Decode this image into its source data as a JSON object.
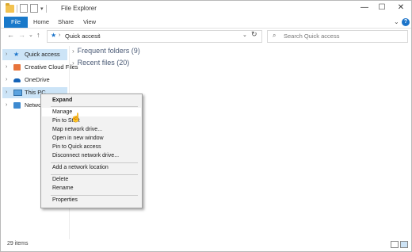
{
  "window": {
    "title": "File Explorer",
    "controls": {
      "minimize": "—",
      "maximize": "☐",
      "close": "✕"
    }
  },
  "ribbon": {
    "tabs": [
      "File",
      "Home",
      "Share",
      "View"
    ],
    "help": "?",
    "expand_chevron": "⌄"
  },
  "nav": {
    "back": "←",
    "forward": "→",
    "recent": "⌄",
    "up": "↑",
    "address_location": "Quick access",
    "address_separator": "›",
    "address_dropdown": "⌄",
    "refresh": "↻",
    "search_placeholder": "Search Quick access"
  },
  "sidebar": {
    "items": [
      {
        "label": "Quick access",
        "icon": "star-icon",
        "selected": true
      },
      {
        "label": "Creative Cloud Files",
        "icon": "creative-cloud-icon",
        "selected": false
      },
      {
        "label": "OneDrive",
        "icon": "cloud-icon",
        "selected": false
      },
      {
        "label": "This PC",
        "icon": "computer-icon",
        "selected": true
      },
      {
        "label": "Network",
        "icon": "network-icon",
        "selected": false
      }
    ],
    "expander": "›"
  },
  "content": {
    "groups": [
      {
        "label": "Frequent folders (9)"
      },
      {
        "label": "Recent files (20)"
      }
    ]
  },
  "context_menu": {
    "items": [
      "Expand",
      "Manage",
      "Pin to Start",
      "Map network drive...",
      "Open in new window",
      "Pin to Quick access",
      "Disconnect network drive...",
      "Add a network location",
      "Delete",
      "Rename",
      "Properties"
    ],
    "highlighted": "Manage"
  },
  "status": {
    "item_count": "29 items"
  },
  "colors": {
    "accent": "#1979ca",
    "selection": "#cce4f7",
    "group_text": "#4a5a75"
  }
}
